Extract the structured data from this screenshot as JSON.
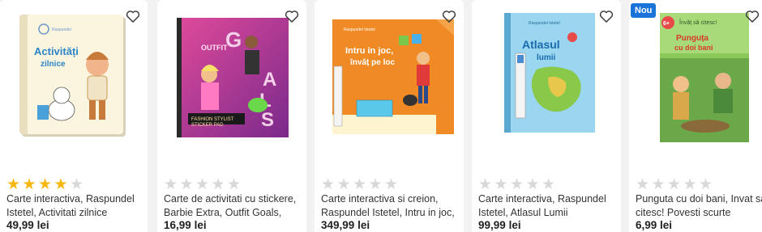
{
  "products": [
    {
      "title": "Carte interactiva, Raspundel Istetel, Activitati zilnice",
      "price": "49,99",
      "currency": "lei",
      "rating": 4,
      "badge": "",
      "cover_text": "Activități zilnice",
      "cover_color": "#fbf4de"
    },
    {
      "title": "Carte de activitati cu stickere, Barbie Extra, Outfit Goals,",
      "price": "16,99",
      "currency": "lei",
      "rating": 0,
      "badge": "",
      "cover_text": "GOALS",
      "cover_color": "#c0337a"
    },
    {
      "title": "Carte interactiva si creion, Raspundel Istetel, Intru in joc,",
      "price": "349,99",
      "currency": "lei",
      "rating": 0,
      "badge": "",
      "cover_text": "Intru in joc, învăț pe loc",
      "cover_color": "#f08a24"
    },
    {
      "title": "Carte interactiva, Raspundel Istetel, Atlasul Lumii",
      "price": "99,99",
      "currency": "lei",
      "rating": 0,
      "badge": "",
      "cover_text": "Atlasul lumii",
      "cover_color": "#8fd0ec"
    },
    {
      "title": "Punguta cu doi bani, Invat sa citesc! Povesti scurte",
      "price": "6,99",
      "currency": "lei",
      "rating": 0,
      "badge": "Nou",
      "cover_text": "Punguța cu doi bani",
      "cover_color": "#7dbd4a"
    }
  ],
  "colors": {
    "star_on": "#f6b80e",
    "star_off": "#d8d8d8",
    "badge": "#1a73d9"
  },
  "icons": {
    "wishlist": "heart-icon",
    "rating": "star-icon"
  }
}
